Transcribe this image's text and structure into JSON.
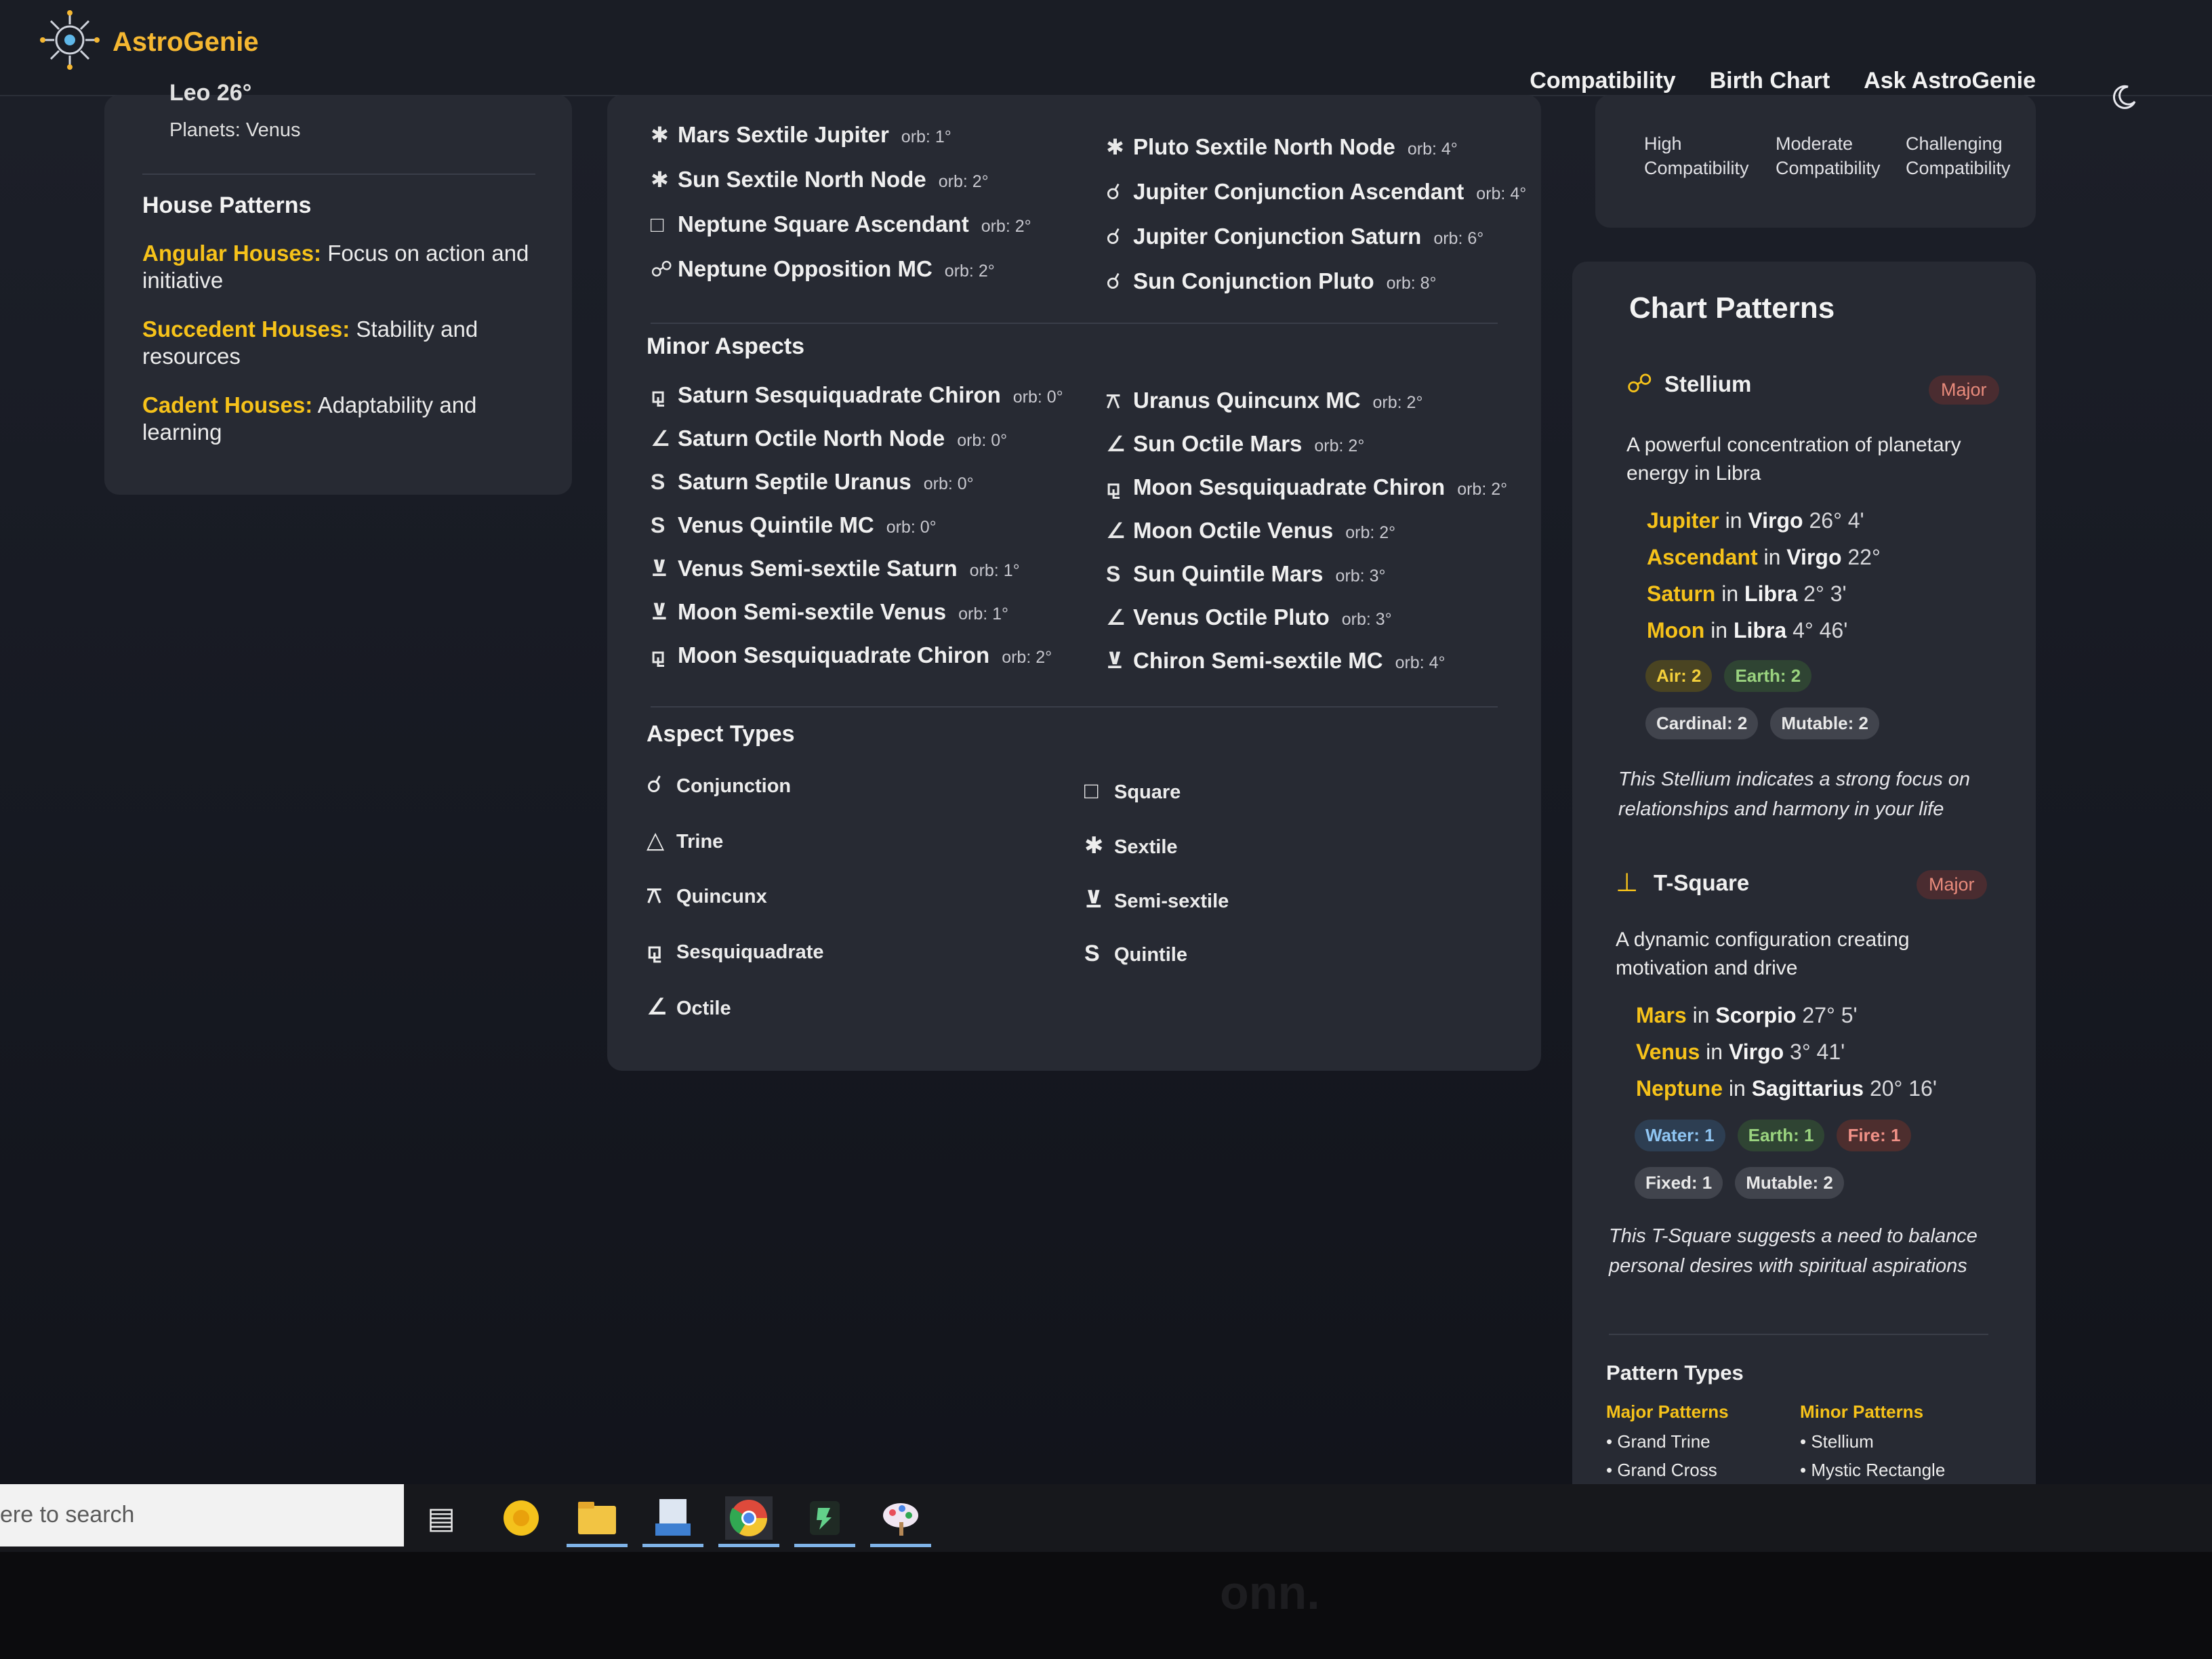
{
  "app": {
    "name": "AstroGenie"
  },
  "nav": [
    "Compatibility",
    "Birth Chart",
    "Ask AstroGenie"
  ],
  "left": {
    "top_partial": "Leo 26°",
    "planets": "Planets: Venus",
    "house_title": "House Patterns",
    "items": [
      {
        "key": "Angular Houses:",
        "text": " Focus on action and initiative"
      },
      {
        "key": "Succedent Houses:",
        "text": " Stability and resources"
      },
      {
        "key": "Cadent Houses:",
        "text": " Adaptability and learning"
      }
    ]
  },
  "major": {
    "left": [
      {
        "sym": "✱",
        "name": "Mars Sextile Jupiter",
        "orb": "orb: 1°"
      },
      {
        "sym": "✱",
        "name": "Sun Sextile North Node",
        "orb": "orb: 2°"
      },
      {
        "sym": "□",
        "name": "Neptune Square Ascendant",
        "orb": "orb: 2°"
      },
      {
        "sym": "☍",
        "name": "Neptune Opposition MC",
        "orb": "orb: 2°"
      }
    ],
    "right": [
      {
        "sym": "✱",
        "name": "Pluto Sextile North Node",
        "orb": "orb: 4°"
      },
      {
        "sym": "☌",
        "name": "Jupiter Conjunction Ascendant",
        "orb": "orb: 4°"
      },
      {
        "sym": "☌",
        "name": "Jupiter Conjunction Saturn",
        "orb": "orb: 6°"
      },
      {
        "sym": "☌",
        "name": "Sun Conjunction Pluto",
        "orb": "orb: 8°"
      }
    ]
  },
  "minor": {
    "title": "Minor Aspects",
    "left": [
      {
        "sym": "⚼",
        "name": "Saturn Sesquiquadrate Chiron",
        "orb": "orb: 0°"
      },
      {
        "sym": "∠",
        "name": "Saturn Octile North Node",
        "orb": "orb: 0°"
      },
      {
        "sym": "S",
        "name": "Saturn Septile Uranus",
        "orb": "orb: 0°"
      },
      {
        "sym": "S",
        "name": "Venus Quintile MC",
        "orb": "orb: 0°"
      },
      {
        "sym": "⊻",
        "name": "Venus Semi-sextile Saturn",
        "orb": "orb: 1°"
      },
      {
        "sym": "⊻",
        "name": "Moon Semi-sextile Venus",
        "orb": "orb: 1°"
      },
      {
        "sym": "⚼",
        "name": "Moon Sesquiquadrate Chiron",
        "orb": "orb: 2°"
      }
    ],
    "right": [
      {
        "sym": "⚻",
        "name": "Uranus Quincunx MC",
        "orb": "orb: 2°"
      },
      {
        "sym": "∠",
        "name": "Sun Octile Mars",
        "orb": "orb: 2°"
      },
      {
        "sym": "⚼",
        "name": "Moon Sesquiquadrate Chiron",
        "orb": "orb: 2°"
      },
      {
        "sym": "∠",
        "name": "Moon Octile Venus",
        "orb": "orb: 2°"
      },
      {
        "sym": "S",
        "name": "Sun Quintile Mars",
        "orb": "orb: 3°"
      },
      {
        "sym": "∠",
        "name": "Venus Octile Pluto",
        "orb": "orb: 3°"
      },
      {
        "sym": "⊻",
        "name": "Chiron Semi-sextile MC",
        "orb": "orb: 4°"
      }
    ]
  },
  "aspect_types": {
    "title": "Aspect Types",
    "left": [
      {
        "sym": "☌",
        "name": "Conjunction"
      },
      {
        "sym": "△",
        "name": "Trine"
      },
      {
        "sym": "⚻",
        "name": "Quincunx"
      },
      {
        "sym": "⚼",
        "name": "Sesquiquadrate"
      },
      {
        "sym": "∠",
        "name": "Octile"
      }
    ],
    "right": [
      {
        "sym": "□",
        "name": "Square"
      },
      {
        "sym": "✱",
        "name": "Sextile"
      },
      {
        "sym": "⊻",
        "name": "Semi-sextile"
      },
      {
        "sym": "S",
        "name": "Quintile"
      }
    ]
  },
  "legend": {
    "high": "High Compatibility",
    "moderate": "Moderate Compatibility",
    "challenging": "Challenging Compatibility"
  },
  "chart_patterns": {
    "title": "Chart Patterns",
    "stellium": {
      "name": "Stellium",
      "badge": "Major",
      "desc": "A powerful concentration of planetary energy in Libra",
      "planets": [
        {
          "p": "Jupiter",
          "sign": "Virgo",
          "deg": "26° 4'"
        },
        {
          "p": "Ascendant",
          "sign": "Virgo",
          "deg": "22°"
        },
        {
          "p": "Saturn",
          "sign": "Libra",
          "deg": "2° 3'"
        },
        {
          "p": "Moon",
          "sign": "Libra",
          "deg": "4° 46'"
        }
      ],
      "chips1": [
        "Air: 2",
        "Earth: 2"
      ],
      "chips2": [
        "Cardinal: 2",
        "Mutable: 2"
      ],
      "note": "This Stellium indicates a strong focus on relationships and harmony in your life"
    },
    "tsquare": {
      "name": "T-Square",
      "badge": "Major",
      "desc": "A dynamic configuration creating motivation and drive",
      "planets": [
        {
          "p": "Mars",
          "sign": "Scorpio",
          "deg": "27° 5'"
        },
        {
          "p": "Venus",
          "sign": "Virgo",
          "deg": "3° 41'"
        },
        {
          "p": "Neptune",
          "sign": "Sagittarius",
          "deg": "20° 16'"
        }
      ],
      "chips1": [
        "Water: 1",
        "Earth: 1",
        "Fire: 1"
      ],
      "chips2": [
        "Fixed: 1",
        "Mutable: 2"
      ],
      "note": "This T-Square suggests a need to balance personal desires with spiritual aspirations"
    },
    "types_title": "Pattern Types",
    "major_h": "Major Patterns",
    "minor_h": "Minor Patterns",
    "major_items": [
      "• Grand Trine",
      "• Grand Cross"
    ],
    "minor_items": [
      "• Stellium",
      "• Mystic Rectangle"
    ]
  },
  "the_word_in": "in",
  "taskbar": {
    "search_placeholder": "ere to search"
  },
  "colors": {
    "accent": "#f6c21a",
    "card": "#272a33",
    "background": "#181b24"
  }
}
